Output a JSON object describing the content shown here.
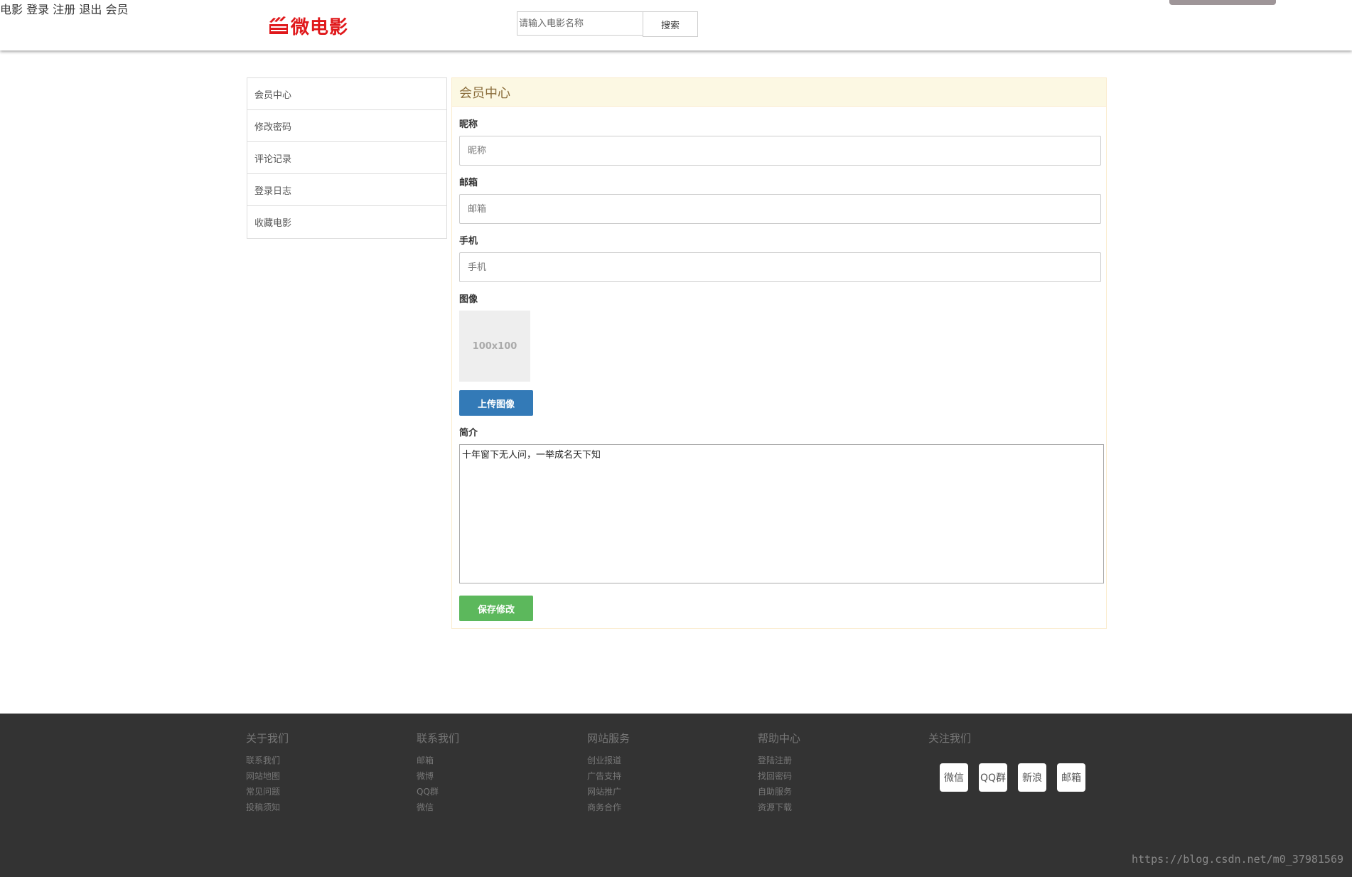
{
  "header": {
    "logo_text": "微电影",
    "search": {
      "placeholder": "请输入电影名称",
      "button_label": "搜索"
    },
    "nav": [
      "电影",
      "登录",
      "注册",
      "退出",
      "会员"
    ]
  },
  "sidebar": {
    "items": [
      {
        "label": "会员中心"
      },
      {
        "label": "修改密码"
      },
      {
        "label": "评论记录"
      },
      {
        "label": "登录日志"
      },
      {
        "label": "收藏电影"
      }
    ]
  },
  "panel": {
    "title": "会员中心",
    "nickname": {
      "label": "昵称",
      "placeholder": "昵称"
    },
    "email": {
      "label": "邮箱",
      "placeholder": "邮箱"
    },
    "phone": {
      "label": "手机",
      "placeholder": "手机"
    },
    "avatar": {
      "label": "图像",
      "placeholder_text": "100x100",
      "upload_label": "上传图像"
    },
    "intro": {
      "label": "简介",
      "value": "十年窗下无人问，一举成名天下知"
    },
    "save_label": "保存修改"
  },
  "footer": {
    "columns": [
      {
        "title": "关于我们",
        "links": [
          "联系我们",
          "网站地图",
          "常见问题",
          "投稿须知"
        ]
      },
      {
        "title": "联系我们",
        "links": [
          "邮箱",
          "微博",
          "QQ群",
          "微信"
        ]
      },
      {
        "title": "网站服务",
        "links": [
          "创业报道",
          "广告支持",
          "网站推广",
          "商务合作"
        ]
      },
      {
        "title": "帮助中心",
        "links": [
          "登陆注册",
          "找回密码",
          "自助服务",
          "资源下载"
        ]
      },
      {
        "title": "关注我们",
        "links": []
      }
    ],
    "social": [
      "微信",
      "QQ群",
      "新浪",
      "邮箱"
    ],
    "watermark": "https://blog.csdn.net/m0_37981569"
  }
}
